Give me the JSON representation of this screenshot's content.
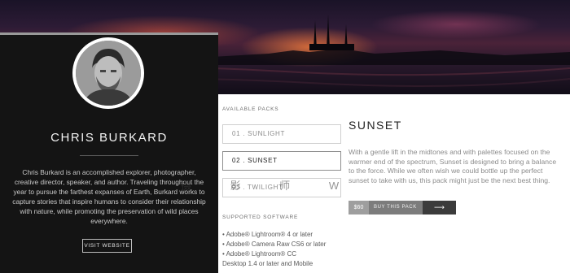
{
  "profile": {
    "name": "CHRIS BURKARD",
    "bio": "Chris Burkard is an accomplished explorer, photographer, creative director, speaker, and author. Traveling throughout the year to pursue the farthest expanses of Earth, Burkard works to capture stories that inspire humans to consider their relationship with nature, while promoting the preservation of wild places everywhere.",
    "visit_label": "VISIT WEBSITE"
  },
  "packs": {
    "heading": "AVAILABLE PACKS",
    "items": [
      {
        "label": "01 . SUNLIGHT",
        "selected": false
      },
      {
        "label": "02 . SUNSET",
        "selected": true
      },
      {
        "label": "03 . TWILIGHT",
        "selected": false
      }
    ]
  },
  "software": {
    "heading": "SUPPORTED SOFTWARE",
    "items": [
      "• Adobe® Lightroom® 4 or later",
      "• Adobe® Camera Raw CS6 or later",
      "• Adobe® Lightroom® CC",
      "Desktop 1.4 or later and Mobile"
    ]
  },
  "detail": {
    "title": "SUNSET",
    "description": "With a gentle lift in the midtones and with palettes focused on the warmer end of the spectrum, Sunset is designed to bring a balance to the force. While we often wish we could bottle up the perfect sunset to take with us, this pack might just be the next best thing.",
    "price": "$60",
    "buy_label": "BUY THIS PACK",
    "buy_arrow": "⟶"
  },
  "watermark": "摄 影 师 W"
}
